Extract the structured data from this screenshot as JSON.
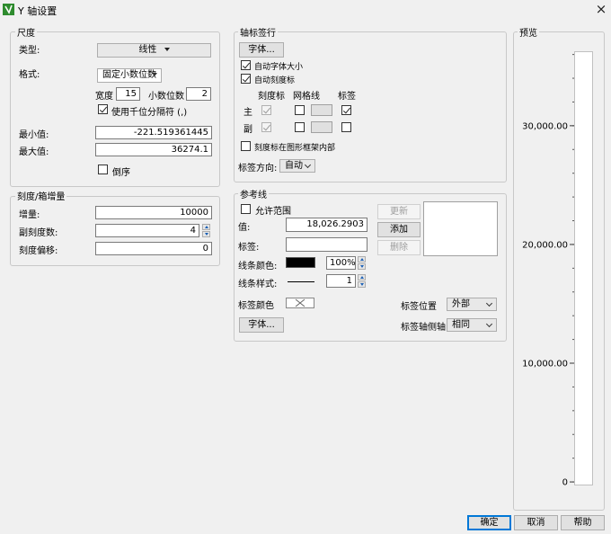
{
  "window": {
    "title": "Y 轴设置",
    "close_icon": "×"
  },
  "scale": {
    "group_label": "尺度",
    "type_label": "类型:",
    "type_value": "线性",
    "format_label": "格式:",
    "format_value": "固定小数位数",
    "width_label": "宽度",
    "width_value": "15",
    "decimals_label": "小数位数",
    "decimals_value": "2",
    "thousands_label": "使用千位分隔符 (,)",
    "thousands_checked": true,
    "min_label": "最小值:",
    "min_value": "-221.519361445",
    "max_label": "最大值:",
    "max_value": "36274.1",
    "reverse_label": "倒序",
    "reverse_checked": false
  },
  "ticks": {
    "group_label": "刻度/箱增量",
    "increment_label": "增量:",
    "increment_value": "10000",
    "minor_label": "副刻度数:",
    "minor_value": "4",
    "offset_label": "刻度偏移:",
    "offset_value": "0"
  },
  "axis_labels": {
    "group_label": "轴标签行",
    "font_button": "字体...",
    "auto_font_label": "自动字体大小",
    "auto_font_checked": true,
    "auto_ticks_label": "自动刻度标",
    "auto_ticks_checked": true,
    "col_ticks": "刻度标",
    "col_grid": "网格线",
    "col_label": "标签",
    "row_major": "主",
    "row_minor": "副",
    "inside_frame_label": "刻度标在图形框架内部",
    "inside_frame_checked": false,
    "orientation_label": "标签方向:",
    "orientation_value": "自动"
  },
  "reference_line": {
    "group_label": "参考线",
    "allow_range_label": "允许范围",
    "allow_range_checked": false,
    "value_label": "值:",
    "value": "18,026.2903",
    "label_label": "标签:",
    "label_value": "",
    "line_color_label": "线条颜色:",
    "line_color": "#000000",
    "opacity_value": "100%",
    "line_style_label": "线条样式:",
    "line_width_value": "1",
    "label_color_label": "标签颜色",
    "label_color_icon": "x-swatch-icon",
    "font_button": "字体...",
    "label_pos_label": "标签位置",
    "label_pos_value": "外部",
    "label_side_label": "标签轴侧轴",
    "label_side_value": "相同",
    "update_button": "更新",
    "add_button": "添加",
    "delete_button": "删除"
  },
  "preview": {
    "group_label": "预览",
    "tick_labels": [
      "30,000.00",
      "20,000.00",
      "10,000.00",
      "0"
    ],
    "tick_values": [
      30000,
      20000,
      10000,
      0
    ],
    "axis_min": -221.519361445,
    "axis_max": 36274.1,
    "minor_ticks": 4
  },
  "footer": {
    "ok": "确定",
    "cancel": "取消",
    "help": "帮助"
  }
}
